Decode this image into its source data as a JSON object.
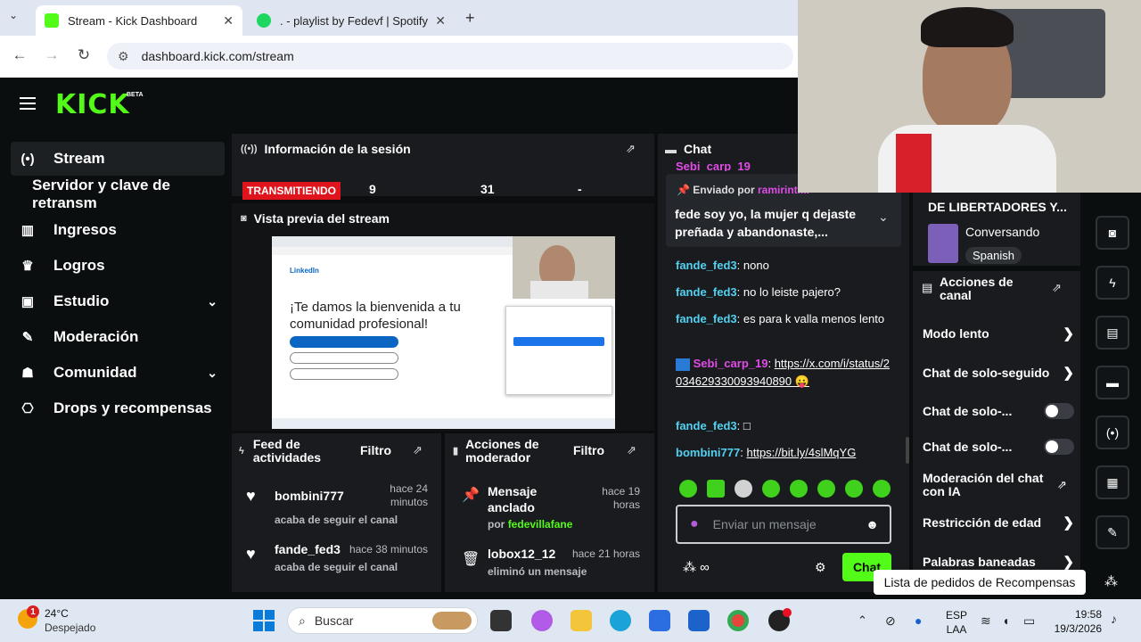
{
  "browser": {
    "tabs": [
      {
        "title": "Stream - Kick Dashboard",
        "active": true
      },
      {
        "title": ". - playlist by Fedevf | Spotify",
        "active": false
      }
    ],
    "url": "dashboard.kick.com/stream"
  },
  "brand": {
    "logo": "KICK",
    "badge": "BETA",
    "accent": "#53fc18"
  },
  "sidebar": {
    "items": [
      {
        "label": "Stream",
        "icon": "broadcast-icon"
      },
      {
        "label": "Servidor y clave de retransm",
        "icon": ""
      },
      {
        "label": "Ingresos",
        "icon": "bar-chart-icon"
      },
      {
        "label": "Logros",
        "icon": "trophy-icon"
      },
      {
        "label": "Estudio",
        "icon": "studio-icon"
      },
      {
        "label": "Moderación",
        "icon": "wrench-icon"
      },
      {
        "label": "Comunidad",
        "icon": "community-icon"
      },
      {
        "label": "Drops y recompensas",
        "icon": "gift-icon"
      }
    ]
  },
  "session": {
    "title": "Información de la sesión",
    "status": "TRANSMITIENDO",
    "stat1": "9",
    "stat2": "31",
    "stat3": "-"
  },
  "preview": {
    "title": "Vista previa del stream",
    "brand": "LinkedIn",
    "welcome": "¡Te damos la bienvenida a tu comunidad profesional!"
  },
  "feed": {
    "title": "Feed de actividades",
    "filter": "Filtro",
    "items": [
      {
        "user": "bombini777",
        "time": "hace 24 minutos",
        "action": "acaba de seguir el canal"
      },
      {
        "user": "fande_fed3",
        "time": "hace 38 minutos",
        "action": "acaba de seguir el canal"
      }
    ]
  },
  "modactions": {
    "title": "Acciones de moderador",
    "filter": "Filtro",
    "items": [
      {
        "title": "Mensaje anclado",
        "time": "hace 19 horas",
        "by_prefix": "por",
        "by": "fedevillafane"
      },
      {
        "title": "lobox12_12",
        "time": "hace 21 horas",
        "sub": "eliminó un mensaje"
      }
    ]
  },
  "chat": {
    "title": "Chat",
    "top_user": "Sebi_carp_19",
    "pinned": {
      "prefix": "Enviado por",
      "user": "ramirinti...",
      "text": "fede soy yo, la mujer q dejaste preñada y abandonaste,..."
    },
    "messages": [
      {
        "user": "fande_fed3",
        "text": "nono"
      },
      {
        "user": "fande_fed3",
        "text": "no lo leiste pajero?"
      },
      {
        "user": "fande_fed3",
        "text": "es para k valla menos lento"
      },
      {
        "user": "Sebi_carp_19",
        "text": "https://x.com/i/status/2034629330093940890 😛"
      },
      {
        "user": "fande_fed3",
        "text": "□"
      },
      {
        "user": "bombini777",
        "text": "https://bit.ly/4slMqYG"
      }
    ],
    "input_placeholder": "Enviar un mensaje",
    "send_label": "Chat"
  },
  "channel": {
    "title_partial": "DE LIBERTADORES Y...",
    "category": "Conversando",
    "language": "Spanish",
    "actions_title": "Acciones de canal",
    "actions": [
      {
        "label": "Modo lento",
        "type": "chevron"
      },
      {
        "label": "Chat de solo-seguido",
        "type": "chevron"
      },
      {
        "label": "Chat de solo-...",
        "type": "toggle"
      },
      {
        "label": "Chat de solo-...",
        "type": "toggle"
      },
      {
        "label": "Moderación del chat con IA",
        "type": "external"
      },
      {
        "label": "Restricción de edad",
        "type": "chevron"
      },
      {
        "label": "Palabras baneadas",
        "type": "chevron"
      }
    ],
    "tooltip": "Lista de pedidos de Recompensas"
  },
  "taskbar": {
    "weather_temp": "24°C",
    "weather_desc": "Despejado",
    "weather_badge": "1",
    "search": "Buscar",
    "lang1": "ESP",
    "lang2": "LAA",
    "time": "19:58",
    "date": "19/3/2026"
  }
}
